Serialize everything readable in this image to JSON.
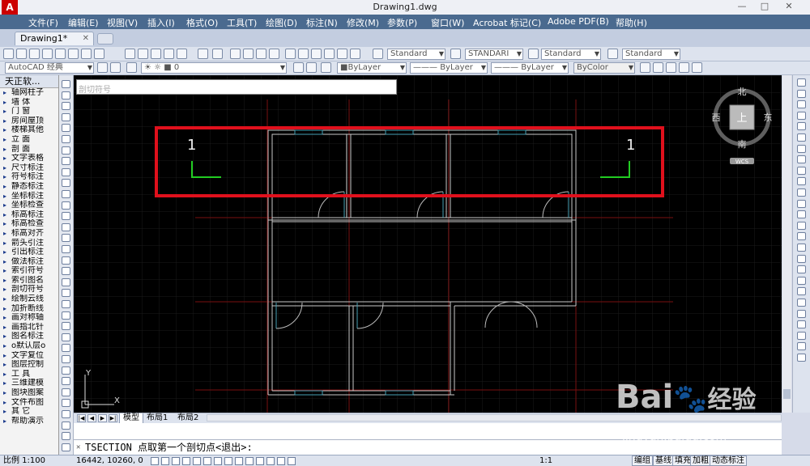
{
  "window": {
    "title": "Drawing1.dwg"
  },
  "menu": [
    "文件(F)",
    "编辑(E)",
    "视图(V)",
    "插入(I)",
    "格式(O)",
    "工具(T)",
    "绘图(D)",
    "标注(N)",
    "修改(M)",
    "参数(P)",
    "窗口(W)",
    "Acrobat 标记(C)",
    "Adobe PDF(B)",
    "帮助(H)"
  ],
  "doc_tab": {
    "label": "Drawing1*",
    "close": "✕"
  },
  "toolbar": {
    "text_style": "Standard",
    "dim_style": "STANDARI",
    "table_style": "Standard",
    "multileader_style": "Standard",
    "workspace": "AutoCAD 经典",
    "layer": "0",
    "color": "ByLayer",
    "linetype": "ByLayer",
    "lineweight": "ByLayer",
    "plotstyle": "ByColor"
  },
  "left_panel": {
    "title": "天正软...",
    "items": [
      "轴网柱子",
      "墙 体",
      "门 窗",
      "房间屋顶",
      "楼梯其他",
      "立 面",
      "剖 面",
      "文字表格",
      "尺寸标注",
      "符号标注",
      "静态标注",
      "坐标标注",
      "坐标检查",
      "标高标注",
      "标高检查",
      "标高对齐",
      "箭头引注",
      "引出标注",
      "做法标注",
      "索引符号",
      "索引图名",
      "剖切符号",
      "绘制云线",
      "加折断线",
      "画对称轴",
      "画指北针",
      "图名标注",
      "o默认层o",
      "文字复位",
      "图层控制",
      "工 具",
      "三维建模",
      "图块图案",
      "文件布图",
      "其 它",
      "帮助演示"
    ]
  },
  "hint_text": "剖切符号",
  "viewcube": {
    "north": "北",
    "south": "南",
    "east": "东",
    "west": "西",
    "top": "上",
    "wcs": "WCS"
  },
  "section_marks": {
    "left": "1",
    "right": "1"
  },
  "ucs": {
    "x": "X",
    "y": "Y"
  },
  "layout_tabs": [
    "模型",
    "布局1",
    "布局2"
  ],
  "command": "TSECTION 点取第一个剖切点<退出>:",
  "status": {
    "scale": "比例 1:100",
    "coords": "16442, 10260, 0",
    "right_buttons": [
      "编组",
      "基线",
      "填充",
      "加粗",
      "动态标注"
    ],
    "annot_scale": "1:1"
  },
  "watermark": {
    "brand": "Bai",
    "brand2": "经验",
    "url": "jingyan.baidu.com"
  },
  "colors": {
    "highlight": "#e0101c",
    "section_mark": "#22cc22",
    "wall": "#c8c8c8",
    "door": "#46a0b4",
    "axis": "#7a0f0f"
  }
}
